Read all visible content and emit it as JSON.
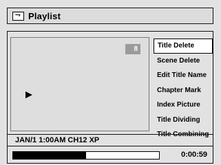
{
  "header": {
    "icon": "playlist-icon",
    "title": "Playlist"
  },
  "preview": {
    "title_number": "8",
    "play_icon": "play-icon"
  },
  "menu": {
    "items": [
      {
        "label": "Title Delete",
        "selected": true
      },
      {
        "label": "Scene Delete",
        "selected": false
      },
      {
        "label": "Edit Title Name",
        "selected": false
      },
      {
        "label": "Chapter Mark",
        "selected": false
      },
      {
        "label": "Index Picture",
        "selected": false
      },
      {
        "label": "Title Dividing",
        "selected": false
      },
      {
        "label": "Title Combining",
        "selected": false
      }
    ]
  },
  "status": {
    "info": "JAN/1 1:00AM CH12 XP"
  },
  "playback": {
    "progress_fraction": 0.5,
    "time": "0:00:59"
  }
}
